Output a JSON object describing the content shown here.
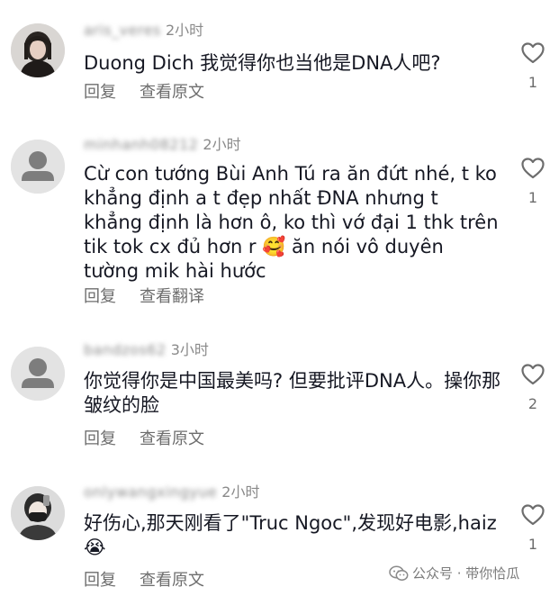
{
  "colors": {
    "text_primary": "#161823",
    "text_secondary": "#6d6d6d",
    "username": "#8a8a8a",
    "background": "#ffffff"
  },
  "actions": {
    "reply": "回复",
    "view_original": "查看原文",
    "view_translation": "查看翻译"
  },
  "comments": [
    {
      "username": "aris_veres",
      "time": "2小时",
      "text": "Duong Dich 我觉得你也当他是DNA人吧?",
      "secondary_action": "查看原文",
      "likes": "1",
      "avatar": "photo-avatar-girl"
    },
    {
      "username": "minhanh08212",
      "time": "2小时",
      "text": "Cừ con tướng Bùi Anh Tú ra ăn đứt  nhé, t ko khẳng định a t đẹp nhất ĐNA nhưng t khẳng định là hơn ô, ko thì vớ đại 1 thk trên tik tok cx đủ hơn r 🥰 ăn nói vô duyên tường mik hài hước",
      "secondary_action": "查看翻译",
      "likes": "1",
      "avatar": "default-avatar"
    },
    {
      "username": "bandzos62",
      "time": "3小时",
      "text": "你觉得你是中国最美吗? 但要批评DNA人。操你那皱纹的脸",
      "secondary_action": "查看原文",
      "likes": "2",
      "avatar": "default-avatar"
    },
    {
      "username": "onlywangxingyue",
      "time": "2小时",
      "text": "好伤心,那天刚看了\"Truc Ngoc\",发现好电影,haiz😭",
      "secondary_action": "查看原文",
      "likes": "1",
      "avatar": "photo-avatar-masked"
    }
  ],
  "watermark": {
    "text": "公众号 · 带你恰瓜",
    "icon": "wechat-icon"
  }
}
